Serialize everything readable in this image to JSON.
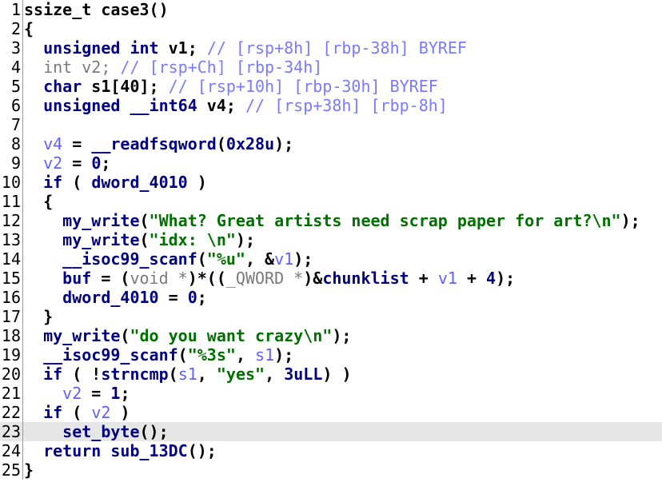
{
  "lines": [
    {
      "num": "1",
      "tokens": [
        {
          "t": "ssize_t case3()",
          "c": "p"
        }
      ]
    },
    {
      "num": "2",
      "tokens": [
        {
          "t": "{",
          "c": "p"
        }
      ]
    },
    {
      "num": "3",
      "tokens": [
        {
          "t": "  ",
          "c": "p"
        },
        {
          "t": "unsigned int",
          "c": "kw"
        },
        {
          "t": " v1; ",
          "c": "p"
        },
        {
          "t": "// [rsp+8h] [rbp-38h] BYREF",
          "c": "cmt"
        }
      ]
    },
    {
      "num": "4",
      "tokens": [
        {
          "t": "  ",
          "c": "p"
        },
        {
          "t": "int v2; ",
          "c": "ty"
        },
        {
          "t": "// [rsp+Ch] [rbp-34h]",
          "c": "cmt"
        }
      ]
    },
    {
      "num": "5",
      "tokens": [
        {
          "t": "  ",
          "c": "p"
        },
        {
          "t": "char",
          "c": "kw"
        },
        {
          "t": " s1[40]; ",
          "c": "p"
        },
        {
          "t": "// [rsp+10h] [rbp-30h] BYREF",
          "c": "cmt"
        }
      ]
    },
    {
      "num": "6",
      "tokens": [
        {
          "t": "  ",
          "c": "p"
        },
        {
          "t": "unsigned __int64",
          "c": "kw"
        },
        {
          "t": " v4; ",
          "c": "p"
        },
        {
          "t": "// [rsp+38h] [rbp-8h]",
          "c": "cmt"
        }
      ]
    },
    {
      "num": "7",
      "tokens": []
    },
    {
      "num": "8",
      "tokens": [
        {
          "t": "  ",
          "c": "p"
        },
        {
          "t": "v4",
          "c": "var"
        },
        {
          "t": " = ",
          "c": "p"
        },
        {
          "t": "__readfsqword",
          "c": "fn"
        },
        {
          "t": "(",
          "c": "p"
        },
        {
          "t": "0x28u",
          "c": "num"
        },
        {
          "t": ");",
          "c": "p"
        }
      ]
    },
    {
      "num": "9",
      "tokens": [
        {
          "t": "  ",
          "c": "p"
        },
        {
          "t": "v2",
          "c": "var"
        },
        {
          "t": " = ",
          "c": "p"
        },
        {
          "t": "0",
          "c": "num"
        },
        {
          "t": ";",
          "c": "p"
        }
      ]
    },
    {
      "num": "10",
      "tokens": [
        {
          "t": "  ",
          "c": "p"
        },
        {
          "t": "if",
          "c": "kw"
        },
        {
          "t": " ( ",
          "c": "p"
        },
        {
          "t": "dword_4010",
          "c": "gl"
        },
        {
          "t": " )",
          "c": "p"
        }
      ]
    },
    {
      "num": "11",
      "tokens": [
        {
          "t": "  {",
          "c": "p"
        }
      ]
    },
    {
      "num": "12",
      "tokens": [
        {
          "t": "    ",
          "c": "p"
        },
        {
          "t": "my_write",
          "c": "fn"
        },
        {
          "t": "(",
          "c": "p"
        },
        {
          "t": "\"What? Great artists need scrap paper for art?\\n\"",
          "c": "str"
        },
        {
          "t": ");",
          "c": "p"
        }
      ]
    },
    {
      "num": "13",
      "tokens": [
        {
          "t": "    ",
          "c": "p"
        },
        {
          "t": "my_write",
          "c": "fn"
        },
        {
          "t": "(",
          "c": "p"
        },
        {
          "t": "\"idx: \\n\"",
          "c": "str"
        },
        {
          "t": ");",
          "c": "p"
        }
      ]
    },
    {
      "num": "14",
      "tokens": [
        {
          "t": "    ",
          "c": "p"
        },
        {
          "t": "__isoc99_scanf",
          "c": "fn"
        },
        {
          "t": "(",
          "c": "p"
        },
        {
          "t": "\"%u\"",
          "c": "str"
        },
        {
          "t": ", &",
          "c": "p"
        },
        {
          "t": "v1",
          "c": "var"
        },
        {
          "t": ");",
          "c": "p"
        }
      ]
    },
    {
      "num": "15",
      "tokens": [
        {
          "t": "    ",
          "c": "p"
        },
        {
          "t": "buf",
          "c": "gl"
        },
        {
          "t": " = (",
          "c": "p"
        },
        {
          "t": "void *",
          "c": "ty"
        },
        {
          "t": ")*((",
          "c": "p"
        },
        {
          "t": "_QWORD *",
          "c": "ty"
        },
        {
          "t": ")&",
          "c": "p"
        },
        {
          "t": "chunklist",
          "c": "gl"
        },
        {
          "t": " + ",
          "c": "p"
        },
        {
          "t": "v1",
          "c": "var"
        },
        {
          "t": " + ",
          "c": "p"
        },
        {
          "t": "4",
          "c": "num"
        },
        {
          "t": ");",
          "c": "p"
        }
      ]
    },
    {
      "num": "16",
      "tokens": [
        {
          "t": "    ",
          "c": "p"
        },
        {
          "t": "dword_4010",
          "c": "gl"
        },
        {
          "t": " = ",
          "c": "p"
        },
        {
          "t": "0",
          "c": "num"
        },
        {
          "t": ";",
          "c": "p"
        }
      ]
    },
    {
      "num": "17",
      "tokens": [
        {
          "t": "  }",
          "c": "p"
        }
      ]
    },
    {
      "num": "18",
      "tokens": [
        {
          "t": "  ",
          "c": "p"
        },
        {
          "t": "my_write",
          "c": "fn"
        },
        {
          "t": "(",
          "c": "p"
        },
        {
          "t": "\"do you want crazy\\n\"",
          "c": "str"
        },
        {
          "t": ");",
          "c": "p"
        }
      ]
    },
    {
      "num": "19",
      "tokens": [
        {
          "t": "  ",
          "c": "p"
        },
        {
          "t": "__isoc99_scanf",
          "c": "fn"
        },
        {
          "t": "(",
          "c": "p"
        },
        {
          "t": "\"%3s\"",
          "c": "str"
        },
        {
          "t": ", ",
          "c": "p"
        },
        {
          "t": "s1",
          "c": "var"
        },
        {
          "t": ");",
          "c": "p"
        }
      ]
    },
    {
      "num": "20",
      "tokens": [
        {
          "t": "  ",
          "c": "p"
        },
        {
          "t": "if",
          "c": "kw"
        },
        {
          "t": " ( !",
          "c": "p"
        },
        {
          "t": "strncmp",
          "c": "fn"
        },
        {
          "t": "(",
          "c": "p"
        },
        {
          "t": "s1",
          "c": "var"
        },
        {
          "t": ", ",
          "c": "p"
        },
        {
          "t": "\"yes\"",
          "c": "str"
        },
        {
          "t": ", ",
          "c": "p"
        },
        {
          "t": "3uLL",
          "c": "num"
        },
        {
          "t": ") )",
          "c": "p"
        }
      ]
    },
    {
      "num": "21",
      "tokens": [
        {
          "t": "    ",
          "c": "p"
        },
        {
          "t": "v2",
          "c": "var"
        },
        {
          "t": " = ",
          "c": "p"
        },
        {
          "t": "1",
          "c": "num"
        },
        {
          "t": ";",
          "c": "p"
        }
      ]
    },
    {
      "num": "22",
      "tokens": [
        {
          "t": "  ",
          "c": "p"
        },
        {
          "t": "if",
          "c": "kw"
        },
        {
          "t": " ( ",
          "c": "p"
        },
        {
          "t": "v2",
          "c": "var"
        },
        {
          "t": " )",
          "c": "p"
        }
      ]
    },
    {
      "num": "23",
      "highlight": true,
      "tokens": [
        {
          "t": "    ",
          "c": "p"
        },
        {
          "t": "set_byte",
          "c": "fn"
        },
        {
          "t": "();",
          "c": "p"
        }
      ]
    },
    {
      "num": "24",
      "tokens": [
        {
          "t": "  ",
          "c": "p"
        },
        {
          "t": "return",
          "c": "kw"
        },
        {
          "t": " ",
          "c": "p"
        },
        {
          "t": "sub_13DC",
          "c": "fn"
        },
        {
          "t": "();",
          "c": "p"
        }
      ]
    },
    {
      "num": "25",
      "tokens": [
        {
          "t": "}",
          "c": "p"
        }
      ]
    }
  ]
}
